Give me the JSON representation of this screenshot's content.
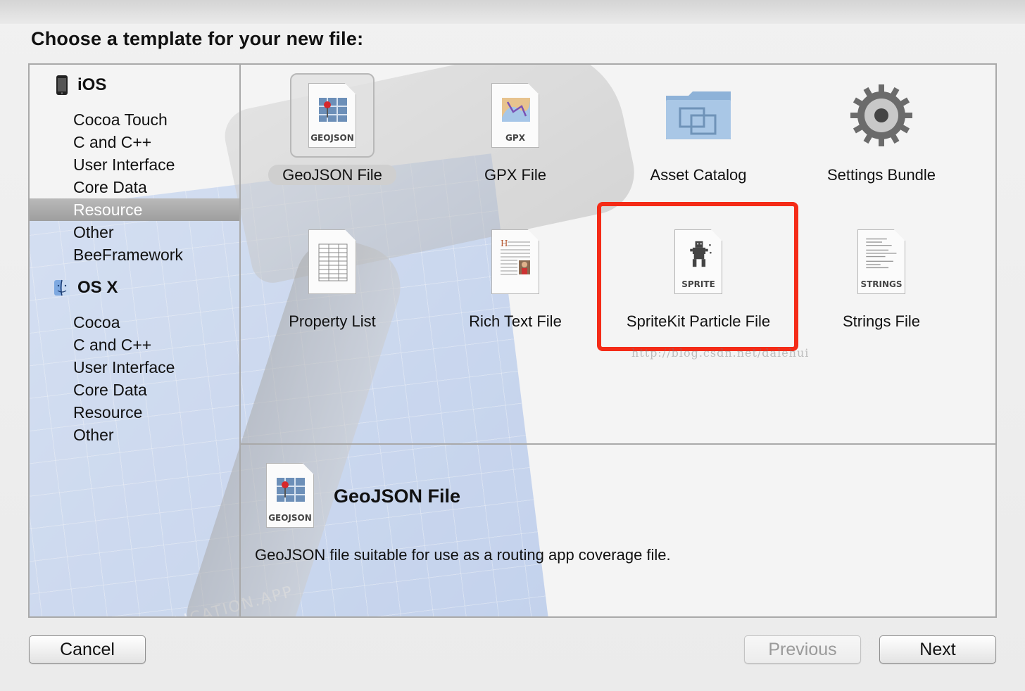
{
  "dialog": {
    "title": "Choose a template for your new file:"
  },
  "sidebar": {
    "sections": [
      {
        "name": "iOS",
        "icon": "iphone-icon",
        "items": [
          "Cocoa Touch",
          "C and C++",
          "User Interface",
          "Core Data",
          "Resource",
          "Other",
          "BeeFramework"
        ],
        "selected": "Resource"
      },
      {
        "name": "OS X",
        "icon": "finder-icon",
        "items": [
          "Cocoa",
          "C and C++",
          "User Interface",
          "Core Data",
          "Resource",
          "Other"
        ]
      }
    ]
  },
  "templates": [
    {
      "label": "GeoJSON File",
      "icon": "geojson-document-icon",
      "tag": "GEOJSON",
      "selected": true
    },
    {
      "label": "GPX File",
      "icon": "gpx-document-icon",
      "tag": "GPX"
    },
    {
      "label": "Asset Catalog",
      "icon": "folder-icon"
    },
    {
      "label": "Settings Bundle",
      "icon": "gear-icon"
    },
    {
      "label": "Property List",
      "icon": "plist-document-icon"
    },
    {
      "label": "Rich Text File",
      "icon": "rtf-document-icon"
    },
    {
      "label": "SpriteKit Particle File",
      "icon": "sprite-document-icon",
      "tag": "SPRITE"
    },
    {
      "label": "Strings File",
      "icon": "strings-document-icon",
      "tag": "STRINGS"
    }
  ],
  "highlight_color": "#f42b17",
  "watermark": "http://blog.csdn.net/dalehui",
  "background_art_text": "PROJECT: APPLICATION.APP",
  "detail": {
    "title": "GeoJSON File",
    "tag": "GEOJSON",
    "description": "GeoJSON file suitable for use as a routing app coverage file."
  },
  "buttons": {
    "cancel": "Cancel",
    "previous": "Previous",
    "next": "Next"
  }
}
